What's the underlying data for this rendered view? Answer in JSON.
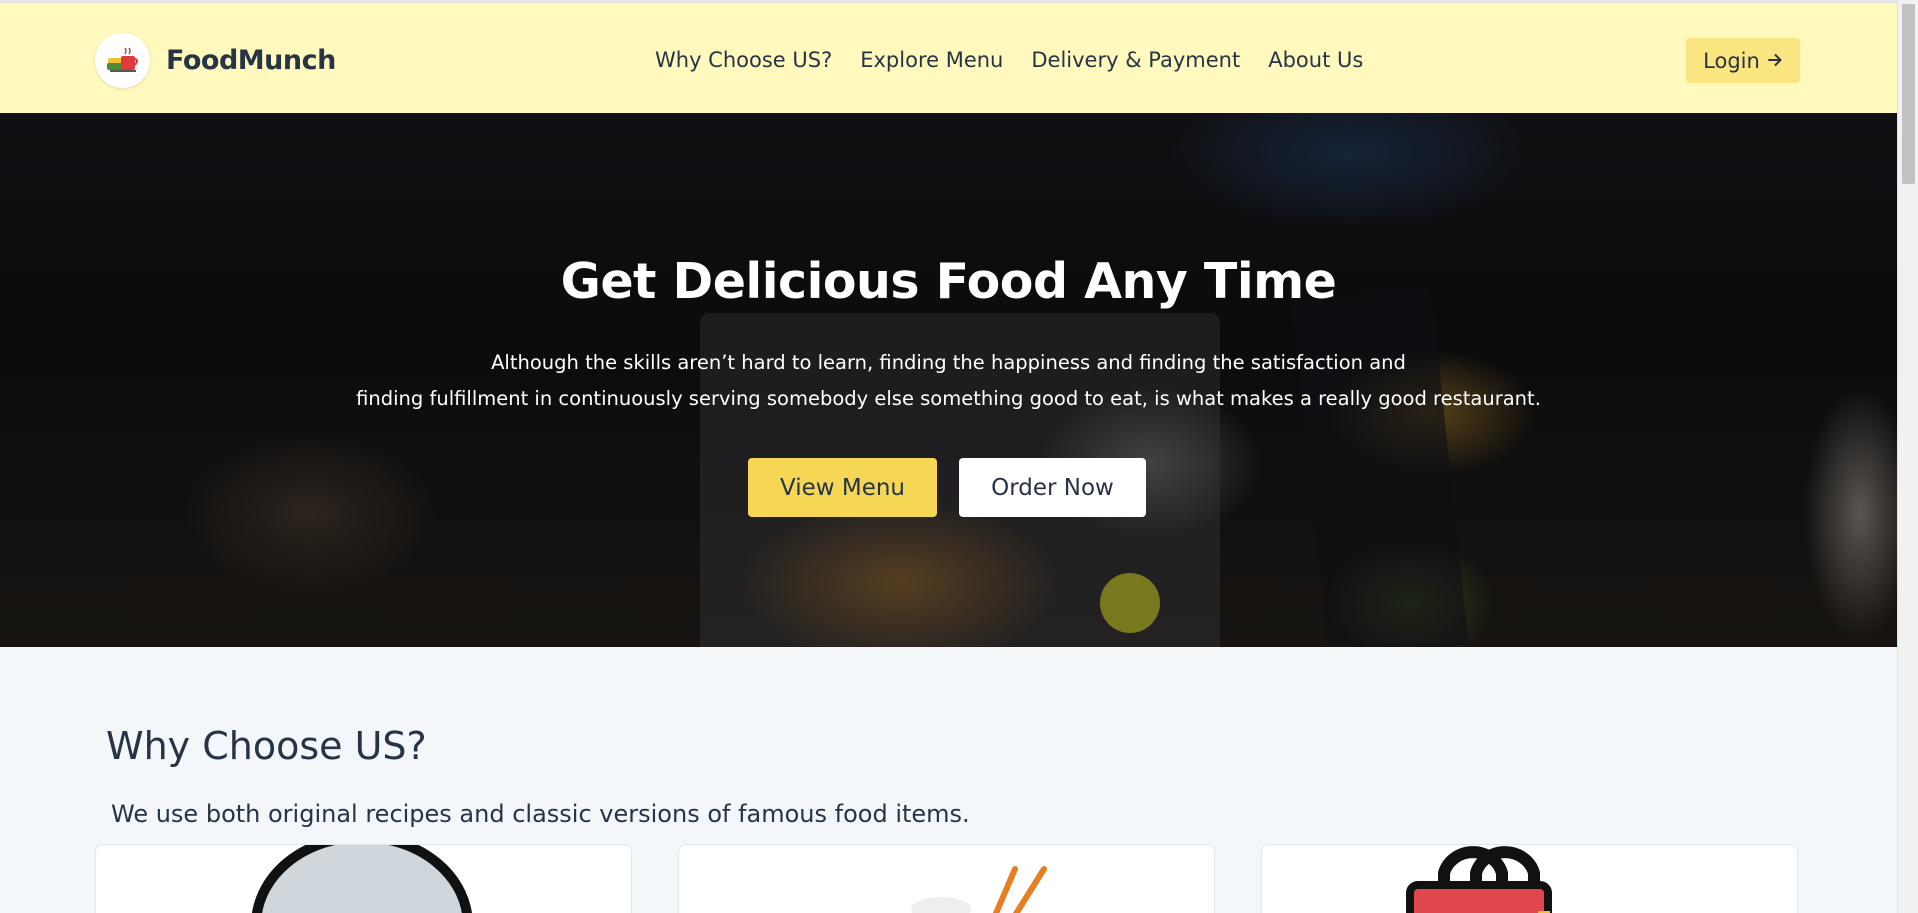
{
  "brand": {
    "name": "FoodMunch",
    "logo_icon": "food-bowl-logo-icon"
  },
  "nav": {
    "links": [
      "Why Choose US?",
      "Explore Menu",
      "Delivery & Payment",
      "About Us"
    ],
    "login_label": "Login",
    "login_icon": "arrow-right-icon"
  },
  "hero": {
    "title": "Get Delicious Food Any Time",
    "desc_line1": "Although the skills aren’t hard to learn, finding the happiness and finding the satisfaction and",
    "desc_line2": "finding fulfillment in continuously serving somebody else something good to eat, is what makes a really good restaurant.",
    "btn_menu": "View Menu",
    "btn_order": "Order Now"
  },
  "why": {
    "title": "Why Choose US?",
    "desc": "We use both original recipes and classic versions of famous food items."
  },
  "colors": {
    "navbar_bg": "#fff9be",
    "accent": "#f5d755",
    "login_bg": "#fbe580",
    "text_dark": "#263445",
    "page_bg": "#f4f7fa"
  }
}
